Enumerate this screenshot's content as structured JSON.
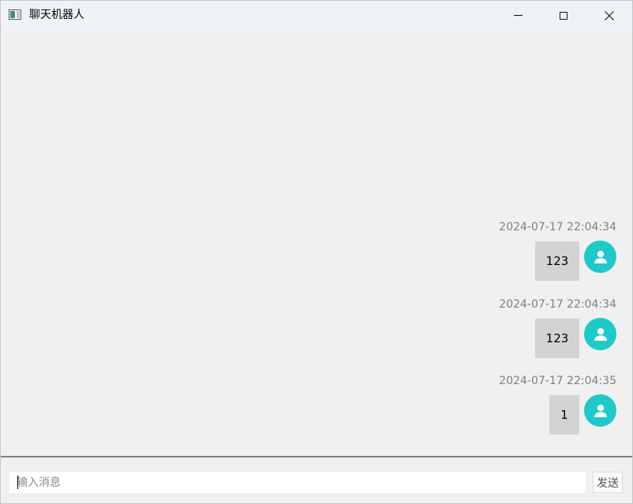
{
  "window": {
    "title": "聊天机器人"
  },
  "messages": [
    {
      "time": "2024-07-17 22:04:34",
      "text": "123",
      "avatar_icon": "user-icon"
    },
    {
      "time": "2024-07-17 22:04:34",
      "text": "123",
      "avatar_icon": "user-icon"
    },
    {
      "time": "2024-07-17 22:04:35",
      "text": "1",
      "avatar_icon": "user-icon"
    }
  ],
  "input": {
    "placeholder": "输入消息",
    "value": ""
  },
  "send_button": {
    "label": "发送"
  },
  "colors": {
    "avatar_bg": "#1ec9c9",
    "bubble_bg": "#d3d3d3",
    "timestamp": "#808080",
    "titlebar_bg": "#eff3f8"
  }
}
